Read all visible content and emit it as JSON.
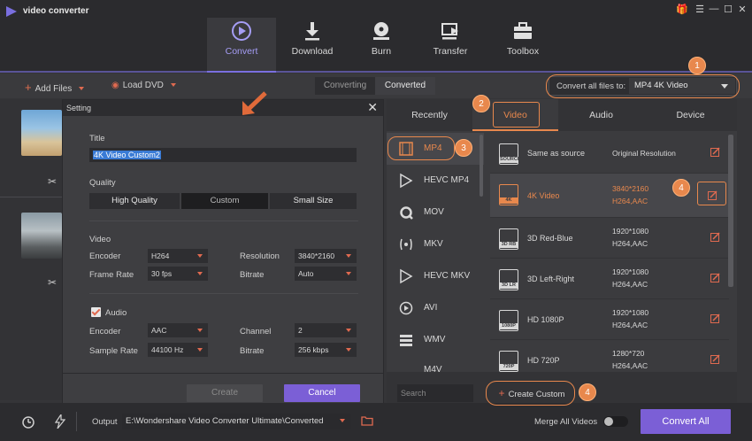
{
  "app": {
    "title": "video converter"
  },
  "nav": [
    {
      "label": "Convert",
      "icon": "convert-icon",
      "active": true
    },
    {
      "label": "Download",
      "icon": "download-icon"
    },
    {
      "label": "Burn",
      "icon": "burn-icon"
    },
    {
      "label": "Transfer",
      "icon": "transfer-icon"
    },
    {
      "label": "Toolbox",
      "icon": "toolbox-icon"
    }
  ],
  "toolbar": {
    "add_files": "Add Files",
    "load_dvd": "Load DVD",
    "converting": "Converting",
    "converted": "Converted",
    "convert_all_label": "Convert all files to:",
    "convert_all_value": "MP4 4K Video"
  },
  "setting": {
    "title": "Setting",
    "title_label": "Title",
    "title_value": "4K Video Custom2",
    "quality_label": "Quality",
    "quality_options": [
      "High Quality",
      "Custom",
      "Small Size"
    ],
    "quality_selected": "Custom",
    "video_label": "Video",
    "encoder_label": "Encoder",
    "encoder_value": "H264",
    "resolution_label": "Resolution",
    "resolution_value": "3840*2160",
    "framerate_label": "Frame Rate",
    "framerate_value": "30 fps",
    "bitrate_label": "Bitrate",
    "video_bitrate_value": "Auto",
    "audio_label": "Audio",
    "audio_checked": true,
    "audio_encoder_value": "AAC",
    "channel_label": "Channel",
    "channel_value": "2",
    "samplerate_label": "Sample Rate",
    "samplerate_value": "44100 Hz",
    "audio_bitrate_value": "256 kbps",
    "create_label": "Create",
    "cancel_label": "Cancel"
  },
  "panel": {
    "tabs": [
      "Recently",
      "Video",
      "Audio",
      "Device"
    ],
    "active_tab": "Video",
    "formats": [
      "MP4",
      "HEVC MP4",
      "MOV",
      "MKV",
      "HEVC MKV",
      "AVI",
      "WMV",
      "M4V"
    ],
    "selected_format": "MP4",
    "options": [
      {
        "name": "Same as source",
        "detail1": "Original Resolution",
        "detail2": "",
        "badge": "SOURCE"
      },
      {
        "name": "4K Video",
        "detail1": "3840*2160",
        "detail2": "H264,AAC",
        "badge": "4K",
        "selected": true
      },
      {
        "name": "3D Red-Blue",
        "detail1": "1920*1080",
        "detail2": "H264,AAC",
        "badge": "3D RB"
      },
      {
        "name": "3D Left-Right",
        "detail1": "1920*1080",
        "detail2": "H264,AAC",
        "badge": "3D LR"
      },
      {
        "name": "HD 1080P",
        "detail1": "1920*1080",
        "detail2": "H264,AAC",
        "badge": "1080P"
      },
      {
        "name": "HD 720P",
        "detail1": "1280*720",
        "detail2": "H264,AAC",
        "badge": "720P"
      }
    ],
    "search_placeholder": "Search",
    "create_custom": "Create Custom"
  },
  "bottom": {
    "output_label": "Output",
    "output_path": "E:\\Wondershare Video Converter Ultimate\\Converted",
    "merge_label": "Merge All Videos",
    "convert_all": "Convert All"
  },
  "callouts": [
    "1",
    "2",
    "3",
    "4",
    "4"
  ],
  "colors": {
    "accent": "#7a6fe0",
    "orange": "#e8884d",
    "red": "#e06a50",
    "button_purple": "#7b5fd6"
  }
}
